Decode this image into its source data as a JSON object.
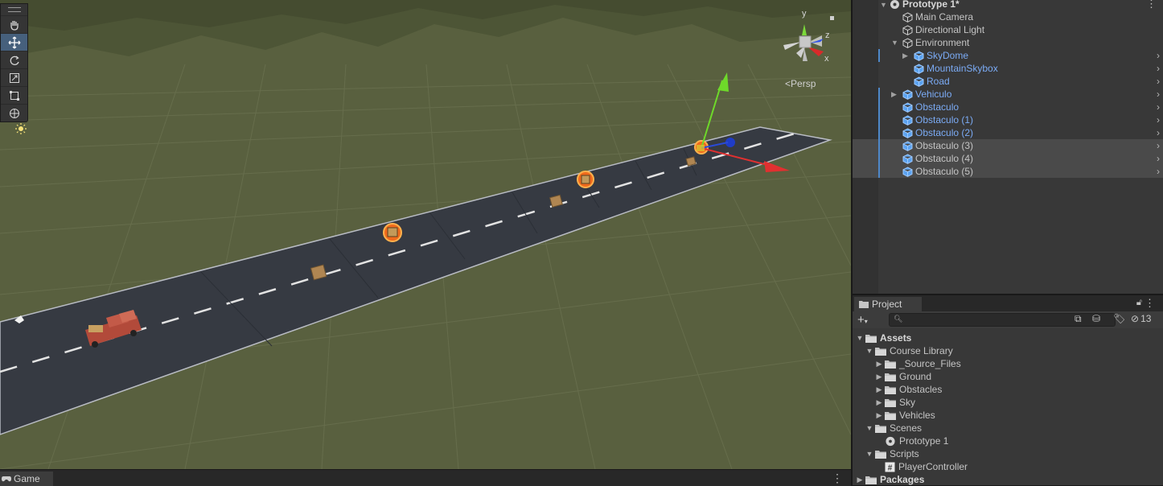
{
  "scene": {
    "view_mode": "Persp",
    "axes": {
      "x": "x",
      "y": "y",
      "z": "z"
    },
    "tools": [
      {
        "name": "hand-tool",
        "active": false
      },
      {
        "name": "move-tool",
        "active": true
      },
      {
        "name": "rotate-tool",
        "active": false
      },
      {
        "name": "scale-tool",
        "active": false
      },
      {
        "name": "rect-tool",
        "active": false
      },
      {
        "name": "transform-tool",
        "active": false
      }
    ]
  },
  "game_tab": {
    "label": "Game"
  },
  "hierarchy": {
    "scene_name": "Prototype 1*",
    "items": [
      {
        "label": "Main Camera",
        "type": "object"
      },
      {
        "label": "Directional Light",
        "type": "object"
      },
      {
        "label": "Environment",
        "type": "object",
        "expanded": true
      },
      {
        "label": "SkyDome",
        "type": "prefab"
      },
      {
        "label": "MountainSkybox",
        "type": "prefab"
      },
      {
        "label": "Road",
        "type": "prefab"
      },
      {
        "label": "Vehiculo",
        "type": "prefab"
      },
      {
        "label": "Obstaculo",
        "type": "prefab"
      },
      {
        "label": "Obstaculo (1)",
        "type": "prefab"
      },
      {
        "label": "Obstaculo (2)",
        "type": "prefab"
      },
      {
        "label": "Obstaculo (3)",
        "type": "prefab",
        "selected": true
      },
      {
        "label": "Obstaculo (4)",
        "type": "prefab",
        "selected": true
      },
      {
        "label": "Obstaculo (5)",
        "type": "prefab",
        "selected": true
      }
    ]
  },
  "project": {
    "tab_label": "Project",
    "hidden_count": "13",
    "tree": [
      {
        "label": "Assets",
        "bold": true,
        "kind": "folder"
      },
      {
        "label": "Course Library",
        "kind": "folder"
      },
      {
        "label": "_Source_Files",
        "kind": "folder"
      },
      {
        "label": "Ground",
        "kind": "folder"
      },
      {
        "label": "Obstacles",
        "kind": "folder"
      },
      {
        "label": "Sky",
        "kind": "folder"
      },
      {
        "label": "Vehicles",
        "kind": "folder"
      },
      {
        "label": "Scenes",
        "kind": "folder"
      },
      {
        "label": "Prototype 1",
        "kind": "scene"
      },
      {
        "label": "Scripts",
        "kind": "folder"
      },
      {
        "label": "PlayerController",
        "kind": "script"
      },
      {
        "label": "Packages",
        "bold": true,
        "kind": "folder"
      }
    ]
  },
  "colors": {
    "prefab_text": "#7babf5",
    "selection_bar": "#4e88c9",
    "active_tool": "#46607c",
    "ground": "#59603f",
    "road": "#363a42"
  }
}
